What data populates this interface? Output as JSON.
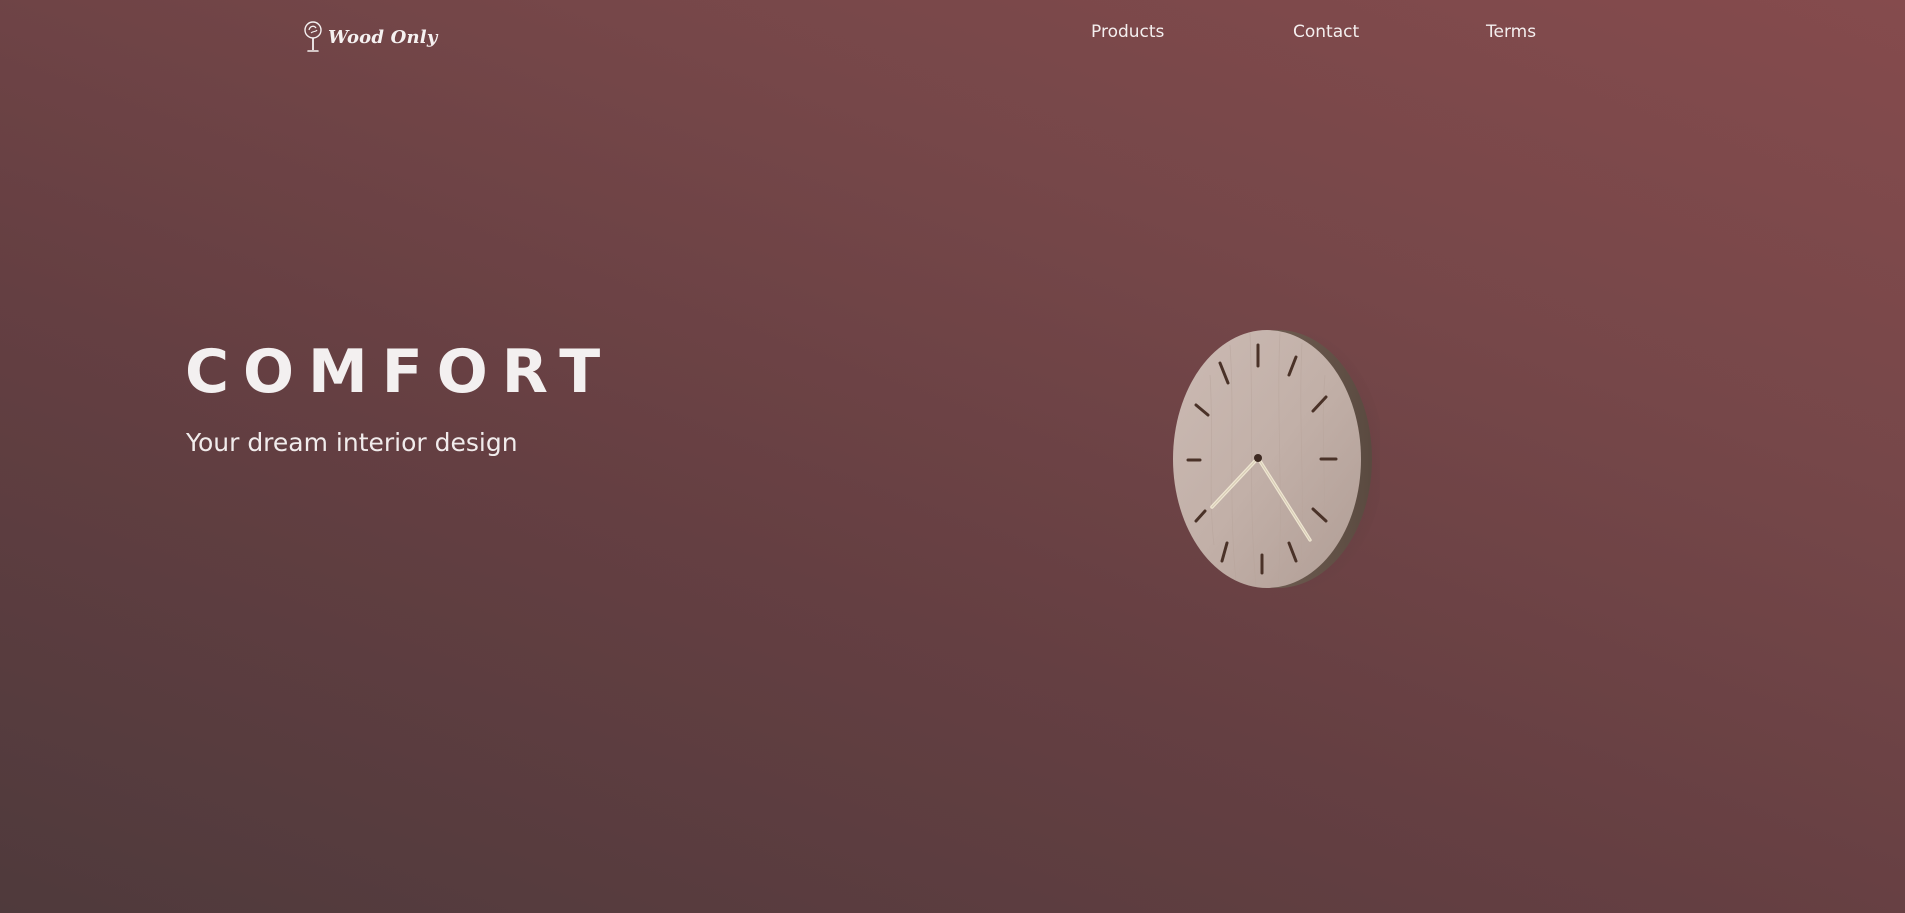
{
  "brand": {
    "name": "Wood Only",
    "logo_icon": "tree-icon"
  },
  "nav": {
    "items": [
      {
        "label": "Products"
      },
      {
        "label": "Contact"
      },
      {
        "label": "Terms"
      }
    ]
  },
  "hero": {
    "title": "COMFORT",
    "subtitle": "Your dream interior design",
    "image": "wooden-wall-clock"
  },
  "colors": {
    "background_light": "#854b4d",
    "background_dark": "#4f3a3c",
    "text": "#f3f0f0",
    "clock_wood": "#c9b8b0"
  }
}
